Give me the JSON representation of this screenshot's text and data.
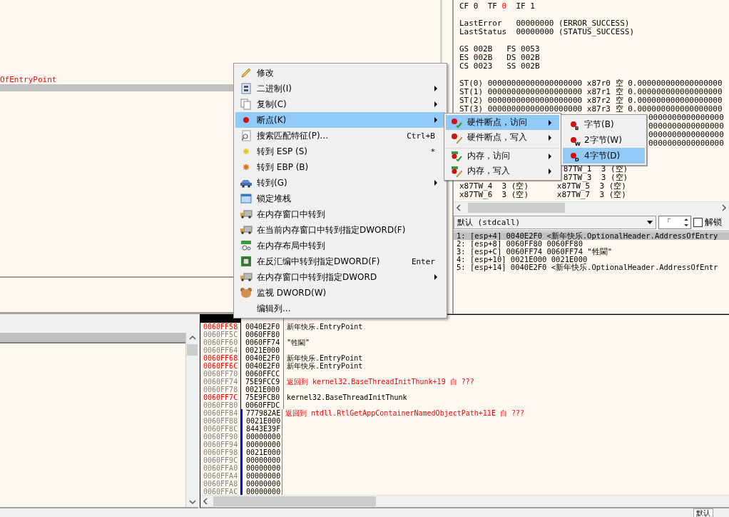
{
  "disassembly": {
    "lines": [
      {
        "text": "OfEntryPoint",
        "kind": "label"
      }
    ]
  },
  "registers": [
    {
      "kind": "flags",
      "lines": [
        {
          "parts": [
            {
              "text": "CF 0  TF ",
              "changed": false
            },
            {
              "text": "0",
              "changed": true
            },
            {
              "text": "  IF 1",
              "changed": false
            }
          ]
        }
      ]
    },
    {
      "kind": "errors",
      "lines": [
        {
          "parts": [
            {
              "text": "LastError   00000000 (ERROR_SUCCESS)",
              "changed": false
            }
          ]
        },
        {
          "parts": [
            {
              "text": "LastStatus  00000000 (STATUS_SUCCESS)",
              "changed": false
            }
          ]
        }
      ]
    },
    {
      "kind": "segments",
      "lines": [
        {
          "parts": [
            {
              "text": "GS 002B   FS 0053",
              "changed": false
            }
          ]
        },
        {
          "parts": [
            {
              "text": "ES 002B   DS 002B",
              "changed": false
            }
          ]
        },
        {
          "parts": [
            {
              "text": "CS 0023   SS 002B",
              "changed": false
            }
          ]
        }
      ]
    },
    {
      "kind": "fpu",
      "lines": [
        {
          "parts": [
            {
              "text": "ST(0) 00000000000000000000 x87r0 空 0.000000000000000000",
              "changed": false
            }
          ]
        },
        {
          "parts": [
            {
              "text": "ST(1) 00000000000000000000 x87r1 空 0.000000000000000000",
              "changed": false
            }
          ]
        },
        {
          "parts": [
            {
              "text": "ST(2) 00000000000000000000 x87r2 空 0.000000000000000000",
              "changed": false
            }
          ]
        },
        {
          "parts": [
            {
              "text": "ST(3) 00000000000000000000 x87r3 空 0.000000000000000000",
              "changed": false
            }
          ]
        },
        {
          "kind": "tail",
          "parts": [
            {
              "text": "0000000000000000",
              "changed": false
            }
          ]
        },
        {
          "kind": "tail",
          "parts": [
            {
              "text": "0000000000000000",
              "changed": false
            }
          ]
        },
        {
          "kind": "tail",
          "parts": [
            {
              "text": "0000000000000000",
              "changed": false
            }
          ]
        },
        {
          "kind": "tail",
          "parts": [
            {
              "text": "0000000000000000",
              "changed": false
            }
          ]
        }
      ]
    },
    {
      "kind": "tags",
      "lines": [
        {
          "kind": "tail",
          "parts": [
            {
              "text": "87TW_1  3 (空)",
              "changed": false
            }
          ]
        },
        {
          "kind": "tail",
          "parts": [
            {
              "text": "87TW_3  3 (空)",
              "changed": false
            }
          ]
        },
        {
          "parts": [
            {
              "text": "x87TW_4  3 (空)      x87TW_5  3 (空)",
              "changed": false
            }
          ]
        },
        {
          "parts": [
            {
              "text": "x87TW_6  3 (空)      x87TW_7  3 (空)",
              "changed": false
            }
          ]
        }
      ]
    }
  ],
  "call_convention": {
    "value": "默认 (stdcall)",
    "arg_count": "「",
    "unlock": {
      "label": "解锁",
      "checked": false
    }
  },
  "arguments": [
    {
      "text": "1: [esp+4] 0040E2F0 <新年快乐.OptionalHeader.AddressOfEntry",
      "selected": true
    },
    {
      "text": "2: [esp+8] 0060FF80 0060FF80",
      "selected": false
    },
    {
      "text": "3: [esp+C] 0060FF74 0060FF74 \"牲閫\"",
      "selected": false
    },
    {
      "text": "4: [esp+10] 0021E000 0021E000",
      "selected": false
    },
    {
      "text": "5: [esp+14] 0040E2F0 <新年快乐.OptionalHeader.AddressOfEntr",
      "selected": false
    }
  ],
  "stack": [
    {
      "highlight": false,
      "selected": true,
      "in_frame": false
    },
    {
      "address": "0060FF58",
      "value": "0040E2F0",
      "comment": "新年快乐.EntryPoint",
      "highlight": true,
      "selected": false,
      "in_frame": false,
      "kind": "plain"
    },
    {
      "address": "0060FF5C",
      "value": "0060FF80",
      "highlight": false,
      "selected": false,
      "in_frame": false
    },
    {
      "address": "0060FF60",
      "value": "0060FF74",
      "comment": "\"牲閫\"",
      "highlight": false,
      "selected": false,
      "in_frame": false,
      "kind": "plain"
    },
    {
      "address": "0060FF64",
      "value": "0021E000",
      "highlight": false,
      "selected": false,
      "in_frame": false
    },
    {
      "address": "0060FF68",
      "value": "0040E2F0",
      "comment": "新年快乐.EntryPoint",
      "highlight": true,
      "selected": false,
      "in_frame": false,
      "kind": "plain"
    },
    {
      "address": "0060FF6C",
      "value": "0040E2F0",
      "comment": "新年快乐.EntryPoint",
      "highlight": true,
      "selected": false,
      "in_frame": false,
      "kind": "plain"
    },
    {
      "address": "0060FF70",
      "value": "0060FFCC",
      "highlight": false,
      "selected": false,
      "in_frame": false
    },
    {
      "address": "0060FF74",
      "value": "75E9FCC9",
      "comment": "返回到 kernel32.BaseThreadInitThunk+19 自 ???",
      "highlight": false,
      "selected": false,
      "in_frame": false,
      "kind": "return"
    },
    {
      "address": "0060FF78",
      "value": "0021E000",
      "highlight": false,
      "selected": false,
      "in_frame": false
    },
    {
      "address": "0060FF7C",
      "value": "75E9FCB0",
      "comment": "kernel32.BaseThreadInitThunk",
      "highlight": true,
      "selected": false,
      "in_frame": false,
      "kind": "plain"
    },
    {
      "address": "0060FF80",
      "value": "0060FFDC",
      "highlight": false,
      "selected": false,
      "in_frame": false
    },
    {
      "address": "0060FF84",
      "value": "777982AE",
      "comment": "返回到 ntdll.RtlGetAppContainerNamedObjectPath+11E 自 ???",
      "highlight": false,
      "selected": false,
      "in_frame": true,
      "kind": "return"
    },
    {
      "address": "0060FF88",
      "value": "0021E000",
      "highlight": false,
      "selected": false,
      "in_frame": true
    },
    {
      "address": "0060FF8C",
      "value": "8443E39F",
      "highlight": false,
      "selected": false,
      "in_frame": true
    },
    {
      "address": "0060FF90",
      "value": "00000000",
      "highlight": false,
      "selected": false,
      "in_frame": true
    },
    {
      "address": "0060FF94",
      "value": "00000000",
      "highlight": false,
      "selected": false,
      "in_frame": true
    },
    {
      "address": "0060FF98",
      "value": "0021E000",
      "highlight": false,
      "selected": false,
      "in_frame": true
    },
    {
      "address": "0060FF9C",
      "value": "00000000",
      "highlight": false,
      "selected": false,
      "in_frame": true
    },
    {
      "address": "0060FFA0",
      "value": "00000000",
      "highlight": false,
      "selected": false,
      "in_frame": true
    },
    {
      "address": "0060FFA4",
      "value": "00000000",
      "highlight": false,
      "selected": false,
      "in_frame": true
    },
    {
      "address": "0060FFA8",
      "value": "00000000",
      "highlight": false,
      "selected": false,
      "in_frame": true
    },
    {
      "address": "0060FFAC",
      "value": "00000000",
      "highlight": false,
      "selected": false,
      "in_frame": true
    }
  ],
  "status_bar": {
    "tab": "默认"
  },
  "context_menu": {
    "items": [
      {
        "label": "修改",
        "selected": false,
        "submenu": false
      },
      {
        "label": "二进制(I)",
        "selected": false,
        "submenu": true
      },
      {
        "label": "复制(C)",
        "selected": false,
        "submenu": true
      },
      {
        "label": "断点(K)",
        "selected": true,
        "submenu": true
      },
      {
        "label": "搜索匹配特征(P)...",
        "shortcut": "Ctrl+B",
        "selected": false,
        "submenu": false
      },
      {
        "label": "转到 ESP (S)",
        "shortcut": "*",
        "selected": false,
        "submenu": false
      },
      {
        "label": "转到 EBP (B)",
        "selected": false,
        "submenu": false
      },
      {
        "label": "转到(G)",
        "selected": false,
        "submenu": true
      },
      {
        "label": "锁定堆栈",
        "selected": false,
        "submenu": false
      },
      {
        "label": "在内存窗口中转到",
        "selected": false,
        "submenu": false
      },
      {
        "label": "在当前内存窗口中转到指定DWORD(F)",
        "selected": false,
        "submenu": false
      },
      {
        "label": "在内存布局中转到",
        "selected": false,
        "submenu": false
      },
      {
        "label": "在反汇编中转到指定DWORD(F)",
        "shortcut": "Enter",
        "selected": false,
        "submenu": false
      },
      {
        "label": "在内存窗口中转到指定DWORD",
        "selected": false,
        "submenu": true
      },
      {
        "label": "监视 DWORD(W)",
        "selected": false,
        "submenu": false
      },
      {
        "label": "编辑列...",
        "selected": false,
        "submenu": false
      }
    ]
  },
  "breakpoint_menu": {
    "items": [
      {
        "label": "硬件断点，访问",
        "selected": true,
        "submenu": true,
        "separator_before": false
      },
      {
        "label": "硬件断点，写入",
        "selected": false,
        "submenu": true,
        "separator_before": false
      },
      {
        "label": "内存，访问",
        "selected": false,
        "submenu": true,
        "separator_before": true
      },
      {
        "label": "内存，写入",
        "selected": false,
        "submenu": true,
        "separator_before": false
      }
    ]
  },
  "size_menu": {
    "items": [
      {
        "label": "字节(B)",
        "tag": "B",
        "selected": false
      },
      {
        "label": "2字节(W)",
        "tag": "W",
        "selected": false
      },
      {
        "label": "4字节(D)",
        "tag": "D",
        "selected": true
      }
    ]
  }
}
